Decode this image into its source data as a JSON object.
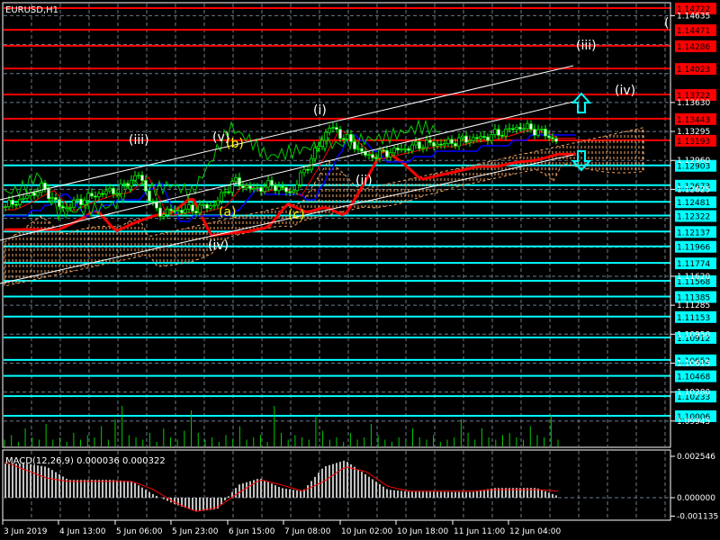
{
  "window": {
    "symbol_title": "EURUSD,H1"
  },
  "colors": {
    "background": "#000000",
    "resistance": "#ff0000",
    "support": "#00ffff",
    "grid": "#6b7b8c",
    "bull": "#00ff00",
    "cloud": "#f4a460",
    "ma_slow": "#ff0000",
    "kijun": "#0000ff",
    "chikou": "#00cc00",
    "channel": "#ffffff",
    "volume": "#00cc00",
    "macd_hist": "#c0c0c0",
    "macd_signal": "#ff0000",
    "wave_white": "#ffffff",
    "wave_yellow": "#ffff00"
  },
  "chart_data": [
    {
      "type": "candlestick",
      "title": "EURUSD,H1",
      "ylim": [
        1.09945,
        1.14722
      ],
      "price_axis_labels": [
        "1.14635",
        "1.13630",
        "1.13295",
        "1.12960",
        "1.12625",
        "1.11620",
        "1.11285",
        "1.10950",
        "1.10615",
        "1.10280",
        "1.09945"
      ],
      "time_axis_labels": [
        "3 Jun 2019",
        "4 Jun 13:00",
        "5 Jun 06:00",
        "5 Jun 23:00",
        "6 Jun 15:00",
        "7 Jun 08:00",
        "10 Jun 02:00",
        "10 Jun 18:00",
        "11 Jun 11:00",
        "12 Jun 04:00"
      ],
      "close_samples": [
        1.1242,
        1.1252,
        1.1265,
        1.124,
        1.125,
        1.1258,
        1.1262,
        1.128,
        1.1235,
        1.1238,
        1.124,
        1.1245,
        1.1272,
        1.1262,
        1.1268,
        1.1258,
        1.1295,
        1.1335,
        1.132,
        1.13,
        1.1305,
        1.131,
        1.1315,
        1.1315,
        1.132,
        1.1322,
        1.1328,
        1.1335,
        1.133,
        1.1318
      ],
      "resistance_levels": [
        "1.14722",
        "1.14471",
        "1.14286",
        "1.14023",
        "1.13722",
        "1.13443",
        "1.13193"
      ],
      "support_levels": [
        "1.12903",
        "1.12673",
        "1.12481",
        "1.12322",
        "1.12137",
        "1.11966",
        "1.11774",
        "1.11568",
        "1.11385",
        "1.11153",
        "1.10912",
        "1.10652",
        "1.10468",
        "1.10233",
        "1.10006"
      ],
      "wave_labels": [
        {
          "text": "(iii)",
          "color": "white"
        },
        {
          "text": "(v)",
          "color": "white"
        },
        {
          "text": "(b)",
          "color": "yellow"
        },
        {
          "text": "(a)",
          "color": "yellow"
        },
        {
          "text": "(iv)",
          "color": "white"
        },
        {
          "text": "(c)",
          "color": "yellow"
        },
        {
          "text": "(i)",
          "color": "white"
        },
        {
          "text": "(ii)",
          "color": "white"
        },
        {
          "text": "(iii)",
          "color": "white"
        },
        {
          "text": "(iv)",
          "color": "white"
        },
        {
          "text": "(",
          "color": "white"
        }
      ],
      "signals": [
        {
          "direction": "up"
        },
        {
          "direction": "down"
        }
      ]
    },
    {
      "type": "bar",
      "title": "Volume",
      "values": [
        3,
        5,
        2,
        8,
        4,
        3,
        10,
        3,
        4,
        2,
        6,
        3,
        5,
        4,
        9,
        3,
        12,
        18,
        5,
        4,
        3,
        6,
        2,
        8,
        4,
        3,
        7,
        16,
        6,
        3,
        4,
        2,
        5,
        3,
        9,
        3,
        4,
        5,
        2,
        18,
        6,
        3,
        5,
        4,
        3,
        14,
        7,
        3,
        4,
        2,
        6,
        3,
        4,
        10,
        5,
        3,
        2,
        4,
        3,
        8,
        4,
        3,
        5,
        2,
        3,
        4,
        12,
        6,
        3,
        8,
        4,
        3,
        5,
        6,
        4,
        3,
        9,
        5,
        4,
        14,
        3
      ]
    },
    {
      "type": "macd",
      "title": "MACD(12,26,9) 0.000036 0.000322",
      "ylim": [
        -0.001135,
        0.002546
      ],
      "axis_labels": [
        "0.002546",
        "0.000000",
        "-0.001135"
      ],
      "histogram_samples": [
        0.0021,
        0.0021,
        0.0019,
        0.0011,
        0.0011,
        0.0011,
        0.001,
        0.0002,
        -0.0004,
        -0.00085,
        -0.0007,
        0.0008,
        0.0012,
        0.0006,
        0.0004,
        0.0019,
        0.0023,
        0.0014,
        0.0005,
        0.00037,
        0.00037,
        0.00035,
        0.00035,
        0.0006,
        0.0006,
        0.0006,
        0.0001
      ],
      "signal_samples": [
        0.0022,
        0.0017,
        0.0012,
        0.001,
        0.001,
        0.001,
        0.001,
        0.0005,
        -0.0003,
        -0.00085,
        -0.0006,
        0.0003,
        0.0011,
        0.0008,
        0.0004,
        0.001,
        0.0019,
        0.0016,
        0.0007,
        0.0004,
        0.0004,
        0.0004,
        0.0004,
        0.0005,
        0.0005,
        0.0005,
        0.0004
      ]
    }
  ]
}
